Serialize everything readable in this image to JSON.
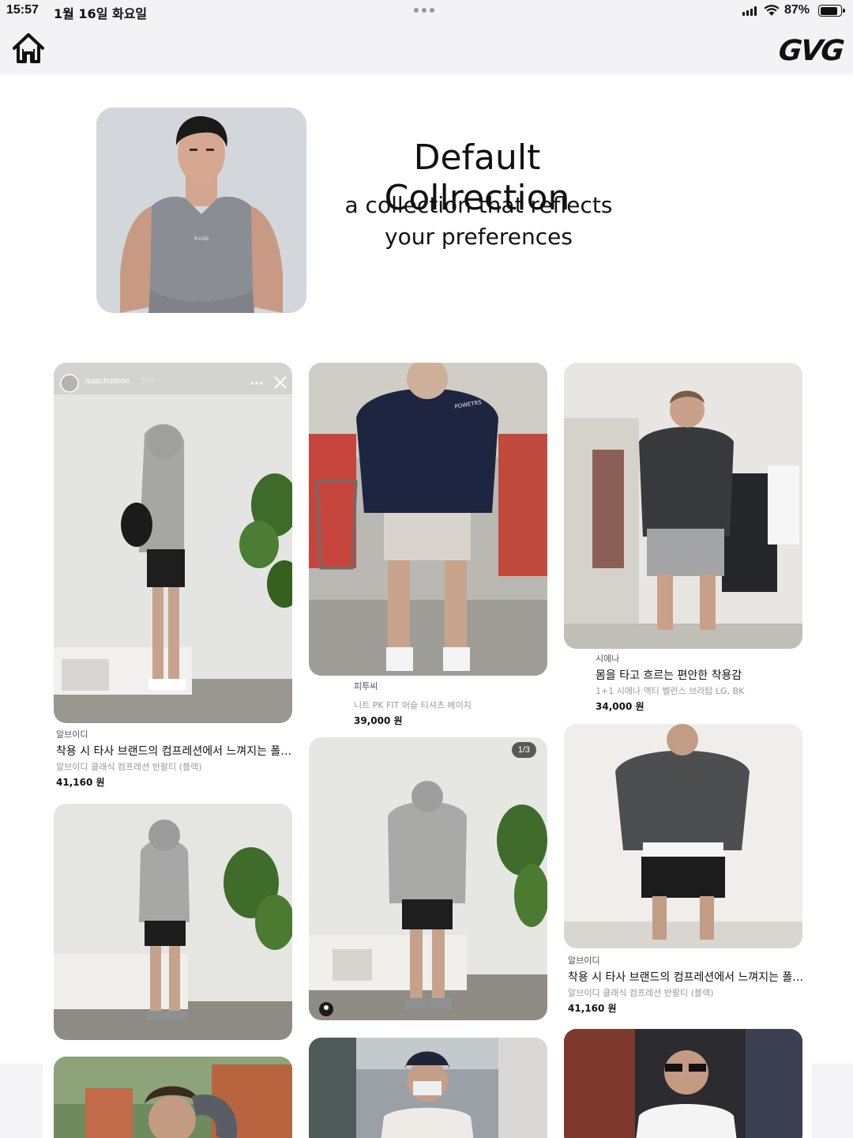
{
  "status_bar": {
    "time": "15:57",
    "date": "1월 16일 화요일",
    "battery": "87%",
    "battery_level": 0.87
  },
  "nav": {
    "home_icon": "home-icon",
    "logo": "GVG"
  },
  "hero": {
    "title": "Default Collrection",
    "subtitle_line1": "a collection that reflects",
    "subtitle_line2": "your preferences",
    "image_print": "R×VD"
  },
  "cards": [
    {
      "story_user": "isaachudson",
      "story_time": "21h",
      "brand": "알브이디",
      "title": "착용 시 타사 브랜드의 컴프레션에서 느껴지는 폴…",
      "sub": "알브이디 클래식 컴프레션 반팔티 (블랙)",
      "price": "41,160 원"
    },
    {
      "hoodie_print": "POWETRS",
      "brand": "피투씨",
      "title": "",
      "sub": "니트 PK FIT 머슬 티셔츠 베이지",
      "price": "39,000 원"
    },
    {
      "brand": "시에나",
      "title": "몸을 타고 흐르는 편안한 착용감",
      "sub": "1+1 시에나 액티 벨런스 브라탑 LG, BK",
      "price": "34,000 원"
    },
    {
      "counter": "1/3"
    },
    {
      "brand": "알브이디",
      "title": "착용 시 타사 브랜드의 컴프레션에서 느껴지는 폴…",
      "sub": "알브이디 클래식 컴프레션 반팔티 (블랙)",
      "price": "41,160 원"
    }
  ],
  "colors": {
    "nav_bg": "#f3f3f6",
    "text": "#111111",
    "muted": "#999999"
  }
}
